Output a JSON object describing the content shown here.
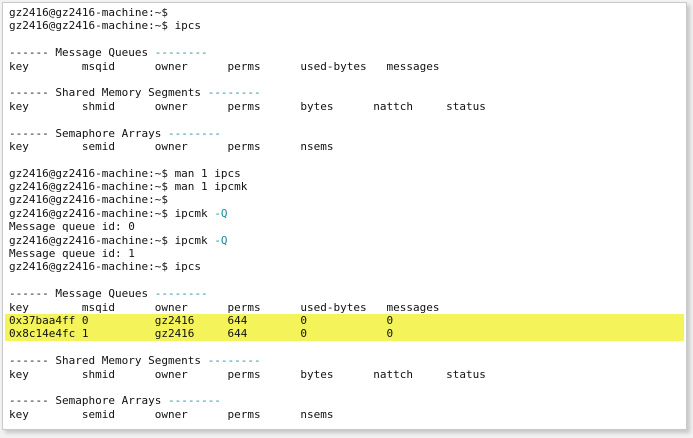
{
  "terminal": {
    "lines": [
      {
        "t": "gz2416@gz2416-machine:~$"
      },
      {
        "t": "gz2416@gz2416-machine:~$ ipcs"
      },
      {
        "t": ""
      },
      {
        "t": "------ Message Queues ",
        "c": "--------"
      },
      {
        "t": "key        msqid      owner      perms      used-bytes   messages"
      },
      {
        "t": ""
      },
      {
        "t": "------ Shared Memory Segments ",
        "c": "--------"
      },
      {
        "t": "key        shmid      owner      perms      bytes      nattch     status"
      },
      {
        "t": ""
      },
      {
        "t": "------ Semaphore Arrays ",
        "c": "--------"
      },
      {
        "t": "key        semid      owner      perms      nsems"
      },
      {
        "t": ""
      },
      {
        "t": "gz2416@gz2416-machine:~$ man 1 ipcs"
      },
      {
        "t": "gz2416@gz2416-machine:~$ man 1 ipcmk"
      },
      {
        "t": "gz2416@gz2416-machine:~$"
      },
      {
        "t": "gz2416@gz2416-machine:~$ ipcmk ",
        "f": "-Q"
      },
      {
        "t": "Message queue id: 0"
      },
      {
        "t": "gz2416@gz2416-machine:~$ ipcmk ",
        "f": "-Q"
      },
      {
        "t": "Message queue id: 1"
      },
      {
        "t": "gz2416@gz2416-machine:~$ ipcs"
      },
      {
        "t": ""
      },
      {
        "t": "------ Message Queues ",
        "c": "--------"
      },
      {
        "t": "key        msqid      owner      perms      used-bytes   messages"
      },
      {
        "t": "0x37baa4ff 0          gz2416     644        0            0",
        "hl": true
      },
      {
        "t": "0x8c14e4fc 1          gz2416     644        0            0",
        "hl": true
      },
      {
        "t": ""
      },
      {
        "t": "------ Shared Memory Segments ",
        "c": "--------"
      },
      {
        "t": "key        shmid      owner      perms      bytes      nattch     status"
      },
      {
        "t": ""
      },
      {
        "t": "------ Semaphore Arrays ",
        "c": "--------"
      },
      {
        "t": "key        semid      owner      perms      nsems"
      }
    ],
    "colors": {
      "highlight": "#f4f45a",
      "accent_cyan": "#168d9c",
      "text": "#111111"
    }
  }
}
